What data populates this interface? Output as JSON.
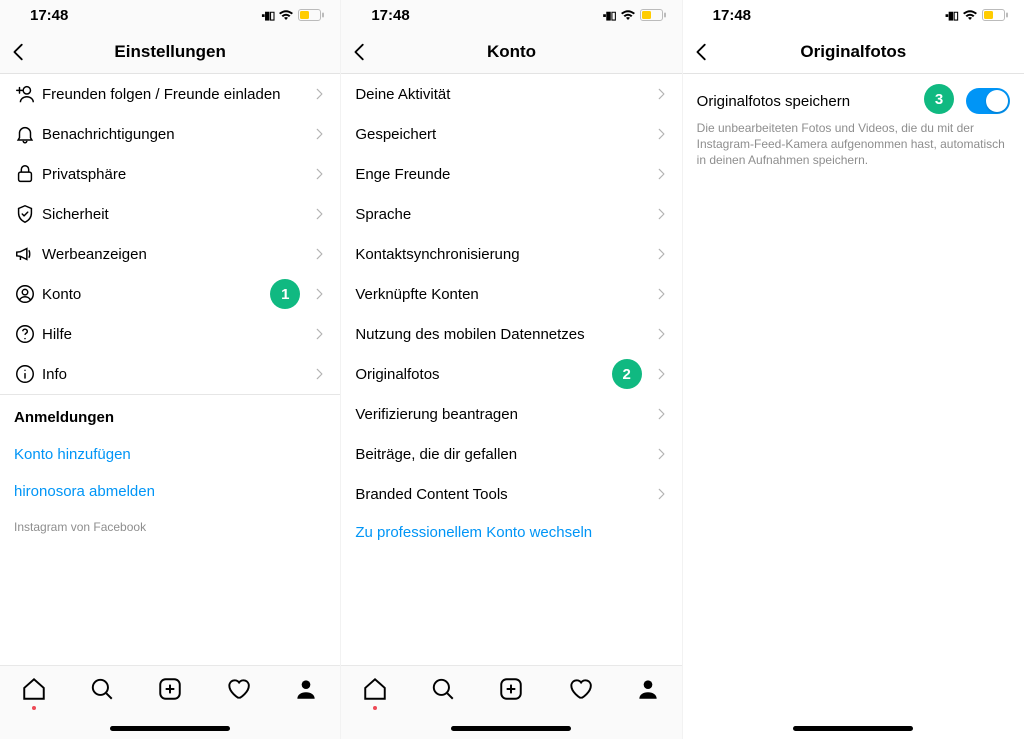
{
  "status": {
    "time": "17:48"
  },
  "badges": {
    "b1": "1",
    "b2": "2",
    "b3": "3"
  },
  "screen1": {
    "title": "Einstellungen",
    "rows": [
      {
        "label": "Freunden folgen / Freunde einladen"
      },
      {
        "label": "Benachrichtigungen"
      },
      {
        "label": "Privatsphäre"
      },
      {
        "label": "Sicherheit"
      },
      {
        "label": "Werbeanzeigen"
      },
      {
        "label": "Konto"
      },
      {
        "label": "Hilfe"
      },
      {
        "label": "Info"
      }
    ],
    "loginsHeader": "Anmeldungen",
    "addAccount": "Konto hinzufügen",
    "logout": "hironosora abmelden",
    "footer": "Instagram von Facebook"
  },
  "screen2": {
    "title": "Konto",
    "rows": [
      {
        "label": "Deine Aktivität"
      },
      {
        "label": "Gespeichert"
      },
      {
        "label": "Enge Freunde"
      },
      {
        "label": "Sprache"
      },
      {
        "label": "Kontaktsynchronisierung"
      },
      {
        "label": "Verknüpfte Konten"
      },
      {
        "label": "Nutzung des mobilen Datennetzes"
      },
      {
        "label": "Originalfotos"
      },
      {
        "label": "Verifizierung beantragen"
      },
      {
        "label": "Beiträge, die dir gefallen"
      },
      {
        "label": "Branded Content Tools"
      }
    ],
    "switchLink": "Zu professionellem Konto wechseln"
  },
  "screen3": {
    "title": "Originalfotos",
    "toggleLabel": "Originalfotos speichern",
    "toggleDesc": "Die unbearbeiteten Fotos und Videos, die du mit der Instagram-Feed-Kamera aufgenommen hast, automatisch in deinen Aufnahmen speichern."
  }
}
